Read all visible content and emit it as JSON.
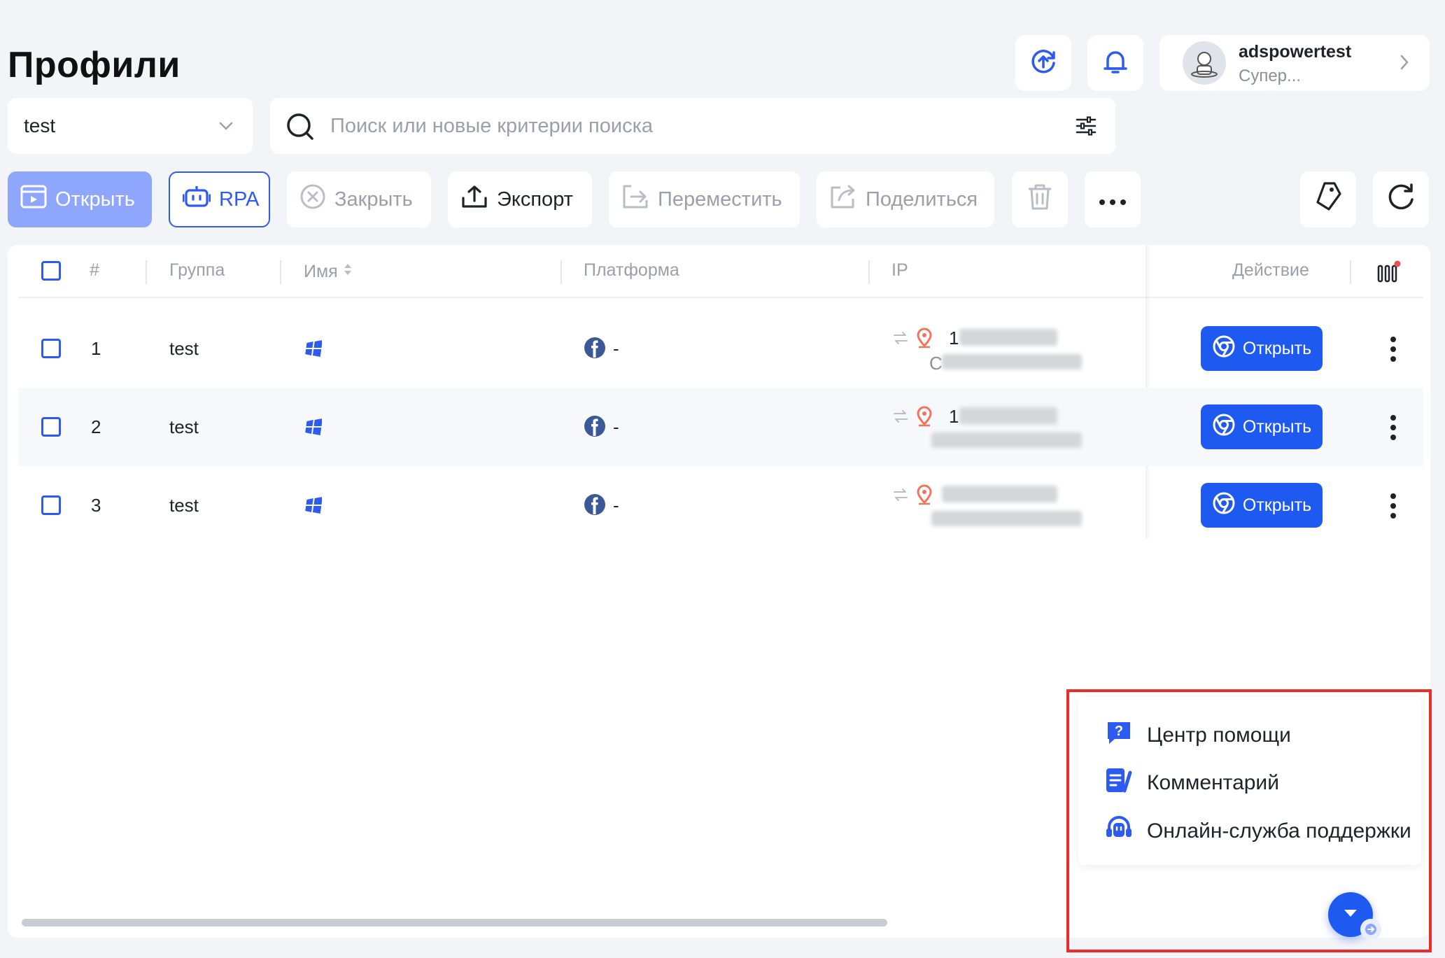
{
  "page": {
    "title": "Профили"
  },
  "user": {
    "name": "adspowertest",
    "role": "Супер..."
  },
  "group_select": {
    "value": "test"
  },
  "search": {
    "placeholder": "Поиск или новые критерии поиска"
  },
  "toolbar": {
    "open": "Открыть",
    "rpa": "RPA",
    "close": "Закрыть",
    "export": "Экспорт",
    "move": "Переместить",
    "share": "Поделиться"
  },
  "table": {
    "headers": {
      "num": "#",
      "group": "Группа",
      "name": "Имя",
      "platform": "Платформа",
      "ip": "IP",
      "action": "Действие"
    },
    "rows": [
      {
        "num": "1",
        "group": "test",
        "platform_value": "-",
        "ip_lead": "1",
        "ip_sub_lead": "C",
        "open_label": "Открыть"
      },
      {
        "num": "2",
        "group": "test",
        "platform_value": "-",
        "ip_lead": "1",
        "ip_sub_lead": "",
        "open_label": "Открыть"
      },
      {
        "num": "3",
        "group": "test",
        "platform_value": "-",
        "ip_lead": "",
        "ip_sub_lead": "",
        "open_label": "Открыть"
      }
    ]
  },
  "help_menu": {
    "items": [
      {
        "label": "Центр помощи",
        "icon": "help-center-icon"
      },
      {
        "label": "Комментарий",
        "icon": "feedback-icon"
      },
      {
        "label": "Онлайн-служба поддержки",
        "icon": "headset-icon"
      }
    ]
  },
  "colors": {
    "accent": "#1f5af0",
    "highlight": "#ee2b2b",
    "background": "#f3f4f7"
  }
}
